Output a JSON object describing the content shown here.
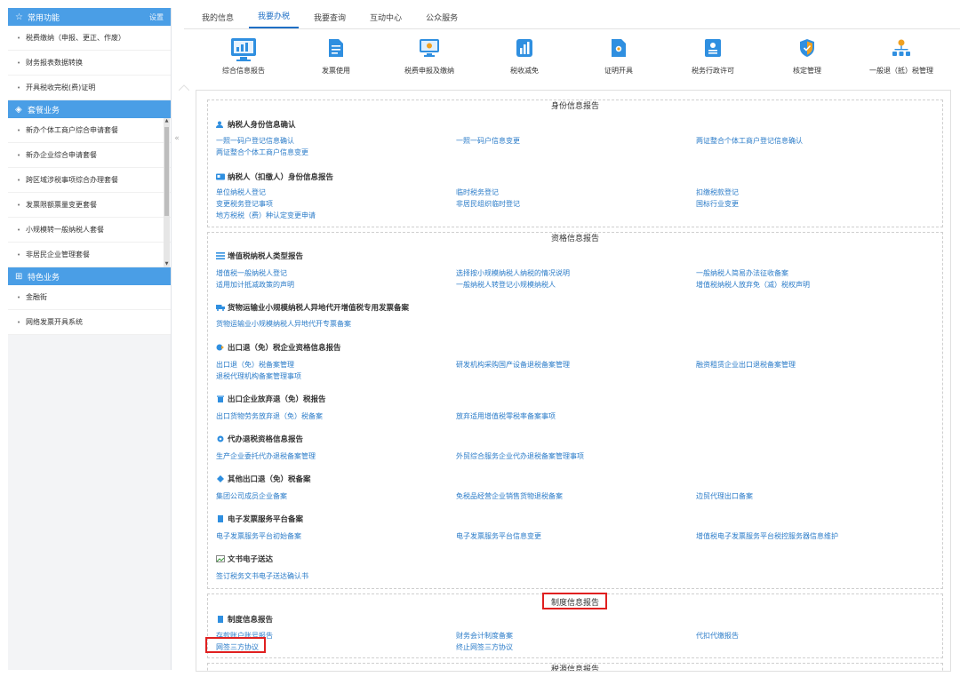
{
  "sidebar": {
    "sections": [
      {
        "title": "常用功能",
        "extra": "设置",
        "icon": "star-icon",
        "items": [
          "税费缴纳（申报、更正、作废）",
          "财务报表数据转换",
          "开具税收完税(费)证明"
        ]
      },
      {
        "title": "套餐业务",
        "icon": "package-icon",
        "items": [
          "新办个体工商户综合申请套餐",
          "新办企业综合申请套餐",
          "跨区域涉税事项综合办理套餐",
          "发票限额票量变更套餐",
          "小规模转一般纳税人套餐",
          "非居民企业管理套餐"
        ]
      },
      {
        "title": "特色业务",
        "icon": "grid-icon",
        "items": [
          "金融街",
          "网络发票开具系统"
        ]
      }
    ]
  },
  "topnav": {
    "tabs": [
      "我的信息",
      "我要办税",
      "我要查询",
      "互动中心",
      "公众服务"
    ],
    "active_index": 1
  },
  "icons": [
    {
      "label": "综合信息报告",
      "icon": "monitor-report-icon",
      "color": "#2f8fe0"
    },
    {
      "label": "发票使用",
      "icon": "invoice-icon",
      "color": "#2f8fe0"
    },
    {
      "label": "税费申报及缴纳",
      "icon": "declare-icon",
      "color": "#2f8fe0"
    },
    {
      "label": "税收减免",
      "icon": "tax-relief-icon",
      "color": "#2f8fe0"
    },
    {
      "label": "证明开具",
      "icon": "certificate-icon",
      "color": "#2f8fe0"
    },
    {
      "label": "税务行政许可",
      "icon": "license-icon",
      "color": "#2f8fe0"
    },
    {
      "label": "核定管理",
      "icon": "shield-check-icon",
      "color": "#f0a020"
    },
    {
      "label": "一般退（抵）税管理",
      "icon": "org-chart-icon",
      "color": "#f0a020"
    }
  ],
  "blocks": [
    {
      "title": "身份信息报告",
      "groups": [
        {
          "title": "纳税人身份信息确认",
          "icon": "user-check-icon",
          "rows": [
            [
              "一照一码户登记信息确认",
              "一照一码户信息变更",
              "两证整合个体工商户登记信息确认"
            ],
            [
              "两证整合个体工商户信息变更",
              "",
              ""
            ]
          ]
        },
        {
          "title": "纳税人（扣缴人）身份信息报告",
          "icon": "id-card-icon",
          "rows": [
            [
              "单位纳税人登记",
              "临时税务登记",
              "扣缴税款登记"
            ],
            [
              "变更税务登记事项",
              "非居民组织临时登记",
              "国标行业变更"
            ],
            [
              "地方税税（费）种认定变更申请",
              "",
              ""
            ]
          ]
        }
      ]
    },
    {
      "title": "资格信息报告",
      "groups": [
        {
          "title": "增值税纳税人类型报告",
          "icon": "type-icon",
          "rows": [
            [
              "增值税一般纳税人登记",
              "选择按小规模纳税人纳税的情况说明",
              "一般纳税人简易办法征收备案"
            ],
            [
              "适用加计抵减政策的声明",
              "一般纳税人转登记小规模纳税人",
              "增值税纳税人放弃免（减）税权声明"
            ]
          ]
        },
        {
          "title": "货物运输业小规模纳税人异地代开增值税专用发票备案",
          "icon": "truck-icon",
          "rows": [
            [
              "货物运输业小规模纳税人异地代开专票备案",
              "",
              ""
            ]
          ]
        },
        {
          "title": "出口退（免）税企业资格信息报告",
          "icon": "export-icon",
          "rows": [
            [
              "出口退（免）税备案管理",
              "研发机构采购国产设备退税备案管理",
              "融资租赁企业出口退税备案管理"
            ],
            [
              "退税代理机构备案管理事项",
              "",
              ""
            ]
          ]
        },
        {
          "title": "出口企业放弃退（免）税报告",
          "icon": "trash-icon",
          "rows": [
            [
              "出口货物劳务放弃退（免）税备案",
              "放弃适用增值税零税率备案事项",
              ""
            ]
          ]
        },
        {
          "title": "代办退税资格信息报告",
          "icon": "gear-icon",
          "rows": [
            [
              "生产企业委托代办退税备案管理",
              "外贸综合服务企业代办退税备案管理事项",
              ""
            ]
          ]
        },
        {
          "title": "其他出口退（免）税备案",
          "icon": "diamond-icon",
          "rows": [
            [
              "集团公司成员企业备案",
              "免税品经营企业销售货物退税备案",
              "边贸代理出口备案"
            ]
          ]
        },
        {
          "title": "电子发票服务平台备案",
          "icon": "doc-icon",
          "rows": [
            [
              "电子发票服务平台初始备案",
              "电子发票服务平台信息变更",
              "增值税电子发票服务平台税控服务器信息维护"
            ]
          ]
        },
        {
          "title": "文书电子送达",
          "icon": "broken-image-icon",
          "rows": [
            [
              "签订税务文书电子送达确认书",
              "",
              ""
            ]
          ]
        }
      ]
    },
    {
      "title": "制度信息报告",
      "groups": [
        {
          "title": "制度信息报告",
          "icon": "doc-icon",
          "rows": [
            [
              "存款账户账号报告",
              "财务会计制度备案",
              "代扣代缴报告"
            ],
            [
              "网签三方协议",
              "终止网签三方协议",
              ""
            ]
          ]
        }
      ]
    },
    {
      "title": "税源信息报告",
      "groups": []
    }
  ]
}
